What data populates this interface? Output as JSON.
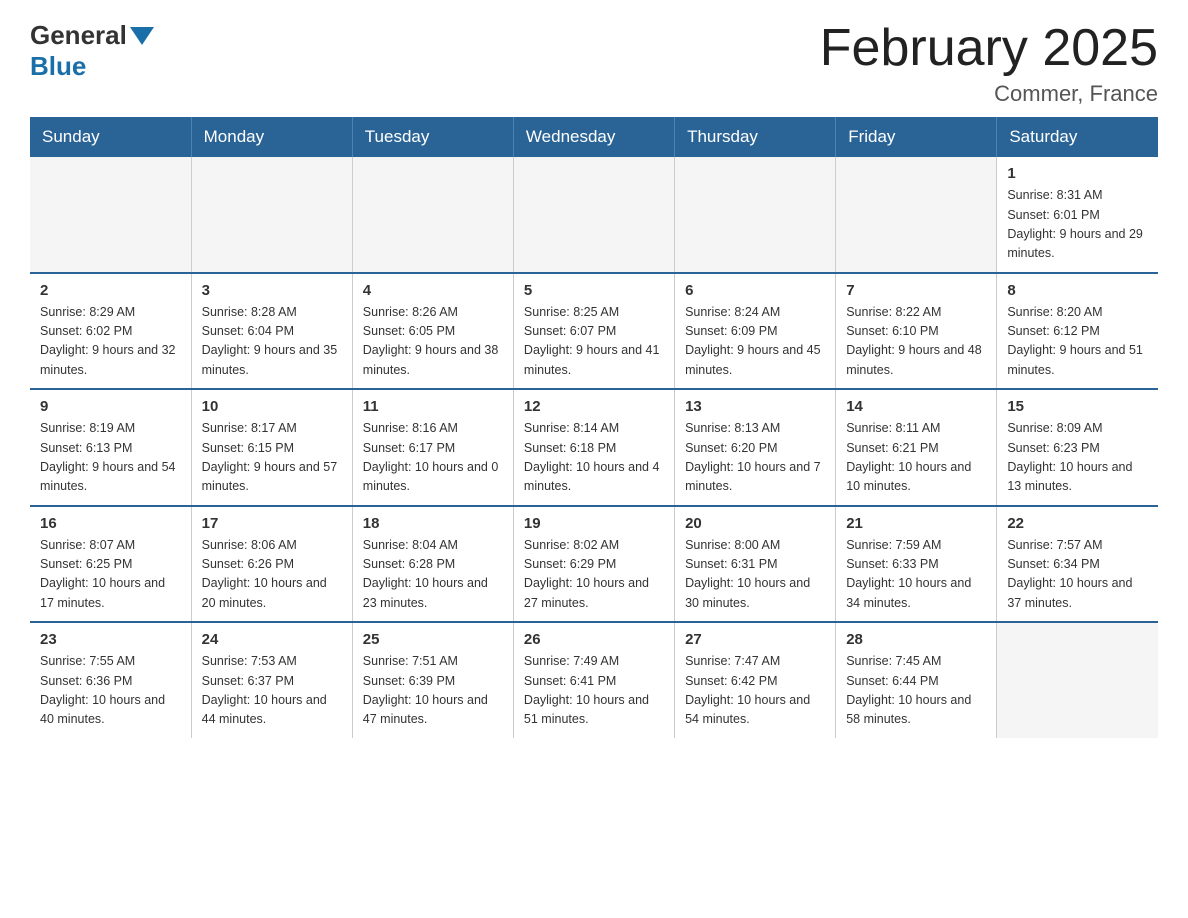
{
  "header": {
    "logo_general": "General",
    "logo_blue": "Blue",
    "title": "February 2025",
    "location": "Commer, France"
  },
  "weekdays": [
    "Sunday",
    "Monday",
    "Tuesday",
    "Wednesday",
    "Thursday",
    "Friday",
    "Saturday"
  ],
  "weeks": [
    [
      {
        "day": "",
        "info": ""
      },
      {
        "day": "",
        "info": ""
      },
      {
        "day": "",
        "info": ""
      },
      {
        "day": "",
        "info": ""
      },
      {
        "day": "",
        "info": ""
      },
      {
        "day": "",
        "info": ""
      },
      {
        "day": "1",
        "info": "Sunrise: 8:31 AM\nSunset: 6:01 PM\nDaylight: 9 hours and 29 minutes."
      }
    ],
    [
      {
        "day": "2",
        "info": "Sunrise: 8:29 AM\nSunset: 6:02 PM\nDaylight: 9 hours and 32 minutes."
      },
      {
        "day": "3",
        "info": "Sunrise: 8:28 AM\nSunset: 6:04 PM\nDaylight: 9 hours and 35 minutes."
      },
      {
        "day": "4",
        "info": "Sunrise: 8:26 AM\nSunset: 6:05 PM\nDaylight: 9 hours and 38 minutes."
      },
      {
        "day": "5",
        "info": "Sunrise: 8:25 AM\nSunset: 6:07 PM\nDaylight: 9 hours and 41 minutes."
      },
      {
        "day": "6",
        "info": "Sunrise: 8:24 AM\nSunset: 6:09 PM\nDaylight: 9 hours and 45 minutes."
      },
      {
        "day": "7",
        "info": "Sunrise: 8:22 AM\nSunset: 6:10 PM\nDaylight: 9 hours and 48 minutes."
      },
      {
        "day": "8",
        "info": "Sunrise: 8:20 AM\nSunset: 6:12 PM\nDaylight: 9 hours and 51 minutes."
      }
    ],
    [
      {
        "day": "9",
        "info": "Sunrise: 8:19 AM\nSunset: 6:13 PM\nDaylight: 9 hours and 54 minutes."
      },
      {
        "day": "10",
        "info": "Sunrise: 8:17 AM\nSunset: 6:15 PM\nDaylight: 9 hours and 57 minutes."
      },
      {
        "day": "11",
        "info": "Sunrise: 8:16 AM\nSunset: 6:17 PM\nDaylight: 10 hours and 0 minutes."
      },
      {
        "day": "12",
        "info": "Sunrise: 8:14 AM\nSunset: 6:18 PM\nDaylight: 10 hours and 4 minutes."
      },
      {
        "day": "13",
        "info": "Sunrise: 8:13 AM\nSunset: 6:20 PM\nDaylight: 10 hours and 7 minutes."
      },
      {
        "day": "14",
        "info": "Sunrise: 8:11 AM\nSunset: 6:21 PM\nDaylight: 10 hours and 10 minutes."
      },
      {
        "day": "15",
        "info": "Sunrise: 8:09 AM\nSunset: 6:23 PM\nDaylight: 10 hours and 13 minutes."
      }
    ],
    [
      {
        "day": "16",
        "info": "Sunrise: 8:07 AM\nSunset: 6:25 PM\nDaylight: 10 hours and 17 minutes."
      },
      {
        "day": "17",
        "info": "Sunrise: 8:06 AM\nSunset: 6:26 PM\nDaylight: 10 hours and 20 minutes."
      },
      {
        "day": "18",
        "info": "Sunrise: 8:04 AM\nSunset: 6:28 PM\nDaylight: 10 hours and 23 minutes."
      },
      {
        "day": "19",
        "info": "Sunrise: 8:02 AM\nSunset: 6:29 PM\nDaylight: 10 hours and 27 minutes."
      },
      {
        "day": "20",
        "info": "Sunrise: 8:00 AM\nSunset: 6:31 PM\nDaylight: 10 hours and 30 minutes."
      },
      {
        "day": "21",
        "info": "Sunrise: 7:59 AM\nSunset: 6:33 PM\nDaylight: 10 hours and 34 minutes."
      },
      {
        "day": "22",
        "info": "Sunrise: 7:57 AM\nSunset: 6:34 PM\nDaylight: 10 hours and 37 minutes."
      }
    ],
    [
      {
        "day": "23",
        "info": "Sunrise: 7:55 AM\nSunset: 6:36 PM\nDaylight: 10 hours and 40 minutes."
      },
      {
        "day": "24",
        "info": "Sunrise: 7:53 AM\nSunset: 6:37 PM\nDaylight: 10 hours and 44 minutes."
      },
      {
        "day": "25",
        "info": "Sunrise: 7:51 AM\nSunset: 6:39 PM\nDaylight: 10 hours and 47 minutes."
      },
      {
        "day": "26",
        "info": "Sunrise: 7:49 AM\nSunset: 6:41 PM\nDaylight: 10 hours and 51 minutes."
      },
      {
        "day": "27",
        "info": "Sunrise: 7:47 AM\nSunset: 6:42 PM\nDaylight: 10 hours and 54 minutes."
      },
      {
        "day": "28",
        "info": "Sunrise: 7:45 AM\nSunset: 6:44 PM\nDaylight: 10 hours and 58 minutes."
      },
      {
        "day": "",
        "info": ""
      }
    ]
  ]
}
